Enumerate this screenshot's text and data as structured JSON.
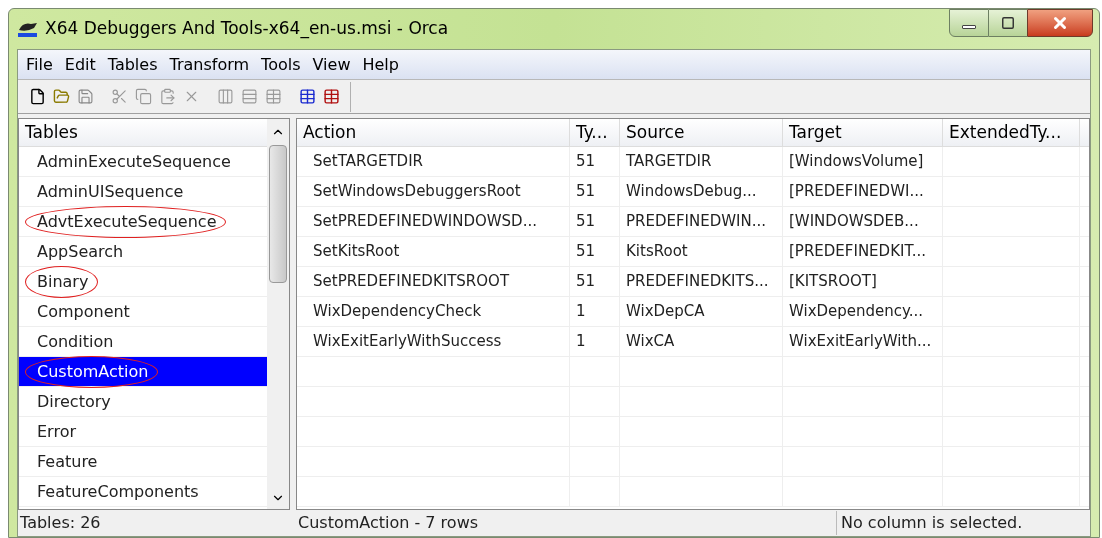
{
  "window": {
    "title": "X64 Debuggers And Tools-x64_en-us.msi - Orca"
  },
  "menu": [
    "File",
    "Edit",
    "Tables",
    "Transform",
    "Tools",
    "View",
    "Help"
  ],
  "tables": {
    "heading": "Tables",
    "items": [
      {
        "label": "AdminExecuteSequence",
        "selected": false,
        "circled": false
      },
      {
        "label": "AdminUISequence",
        "selected": false,
        "circled": false
      },
      {
        "label": "AdvtExecuteSequence",
        "selected": false,
        "circled": true
      },
      {
        "label": "AppSearch",
        "selected": false,
        "circled": false
      },
      {
        "label": "Binary",
        "selected": false,
        "circled": true
      },
      {
        "label": "Component",
        "selected": false,
        "circled": false
      },
      {
        "label": "Condition",
        "selected": false,
        "circled": false
      },
      {
        "label": "CustomAction",
        "selected": true,
        "circled": true
      },
      {
        "label": "Directory",
        "selected": false,
        "circled": false
      },
      {
        "label": "Error",
        "selected": false,
        "circled": false
      },
      {
        "label": "Feature",
        "selected": false,
        "circled": false
      },
      {
        "label": "FeatureComponents",
        "selected": false,
        "circled": false
      }
    ]
  },
  "grid": {
    "columns": [
      "Action",
      "Ty...",
      "Source",
      "Target",
      "ExtendedTy..."
    ],
    "rows": [
      [
        "SetTARGETDIR",
        "51",
        "TARGETDIR",
        "[WindowsVolume]",
        ""
      ],
      [
        "SetWindowsDebuggersRoot",
        "51",
        "WindowsDebug...",
        "[PREDEFINEDWI...",
        ""
      ],
      [
        "SetPREDEFINEDWINDOWSD...",
        "51",
        "PREDEFINEDWIN...",
        "[WINDOWSDEB...",
        ""
      ],
      [
        "SetKitsRoot",
        "51",
        "KitsRoot",
        "[PREDEFINEDKIT...",
        ""
      ],
      [
        "SetPREDEFINEDKITSROOT",
        "51",
        "PREDEFINEDKITS...",
        "[KITSROOT]",
        ""
      ],
      [
        "WixDependencyCheck",
        "1",
        "WixDepCA",
        "WixDependency...",
        ""
      ],
      [
        "WixExitEarlyWithSuccess",
        "1",
        "WixCA",
        "WixExitEarlyWith...",
        ""
      ]
    ]
  },
  "status_bar": [
    "Tables: 26",
    "CustomAction - 7 rows",
    "No column is selected."
  ]
}
